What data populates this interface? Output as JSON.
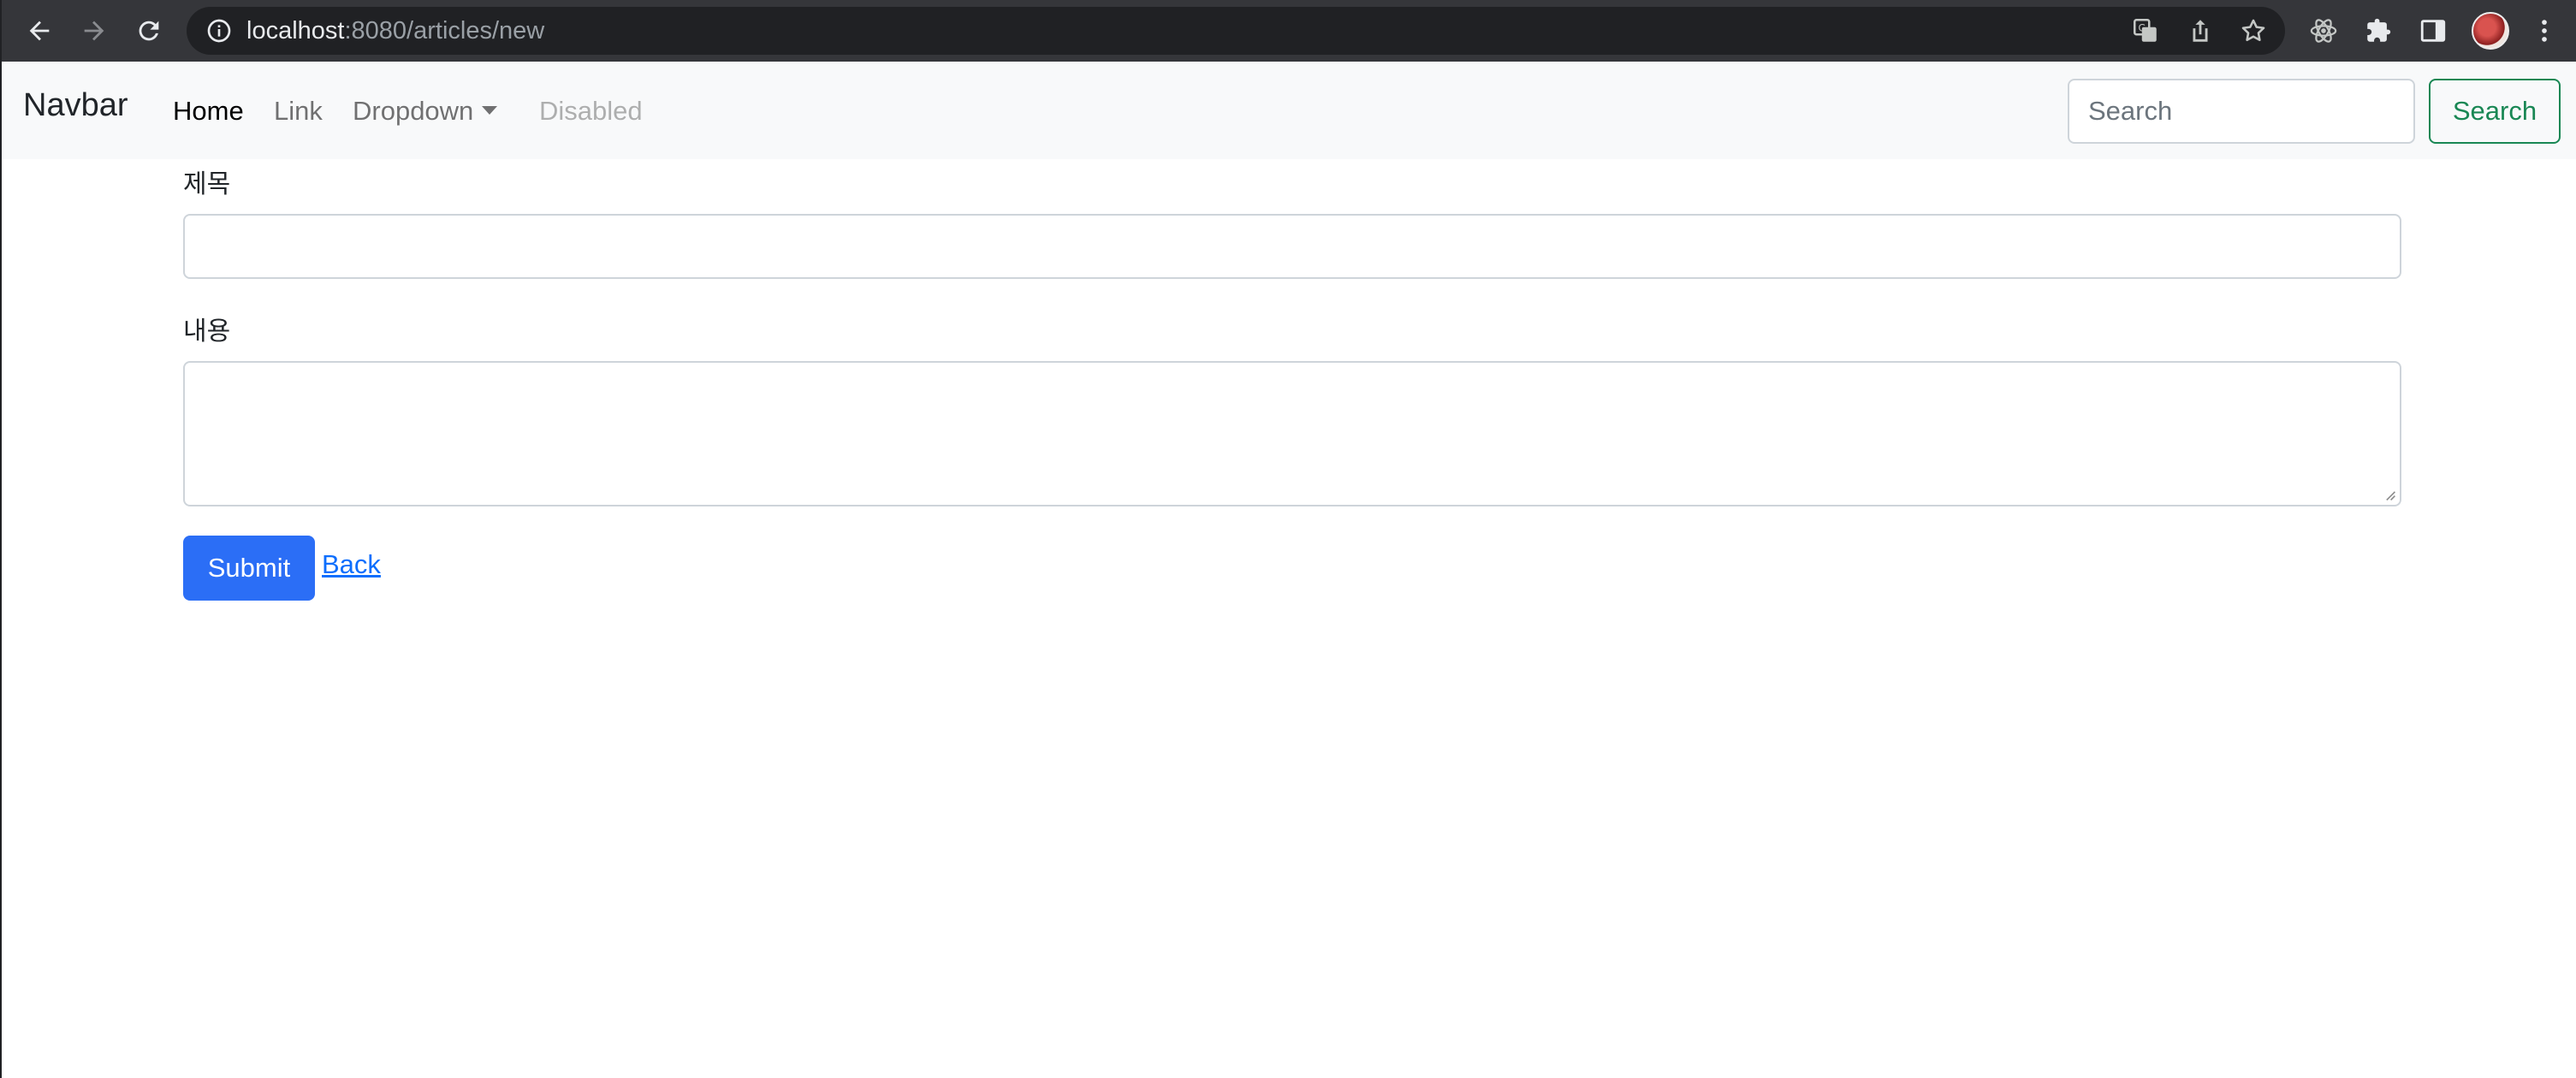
{
  "browser": {
    "url_host": "localhost",
    "url_rest": ":8080/articles/new",
    "icons": [
      "back-arrow-icon",
      "forward-arrow-icon",
      "reload-icon",
      "info-icon",
      "translate-icon",
      "share-icon",
      "bookmark-star-icon",
      "react-devtools-icon",
      "extensions-puzzle-icon",
      "side-panel-icon",
      "profile-avatar",
      "more-menu-icon"
    ]
  },
  "navbar": {
    "brand": "Navbar",
    "links": [
      {
        "label": "Home",
        "state": "active"
      },
      {
        "label": "Link",
        "state": "normal"
      },
      {
        "label": "Dropdown",
        "state": "dropdown"
      },
      {
        "label": "Disabled",
        "state": "disabled"
      }
    ],
    "search_placeholder": "Search",
    "search_button": "Search"
  },
  "form": {
    "title_label": "제목",
    "title_value": "",
    "content_label": "내용",
    "content_value": "",
    "submit_label": "Submit",
    "back_label": "Back"
  },
  "colors": {
    "chrome_bg": "#35363a",
    "navbar_bg": "#f8f9fa",
    "primary": "#2b6ef6",
    "success": "#198754",
    "link": "#0d6efd"
  }
}
